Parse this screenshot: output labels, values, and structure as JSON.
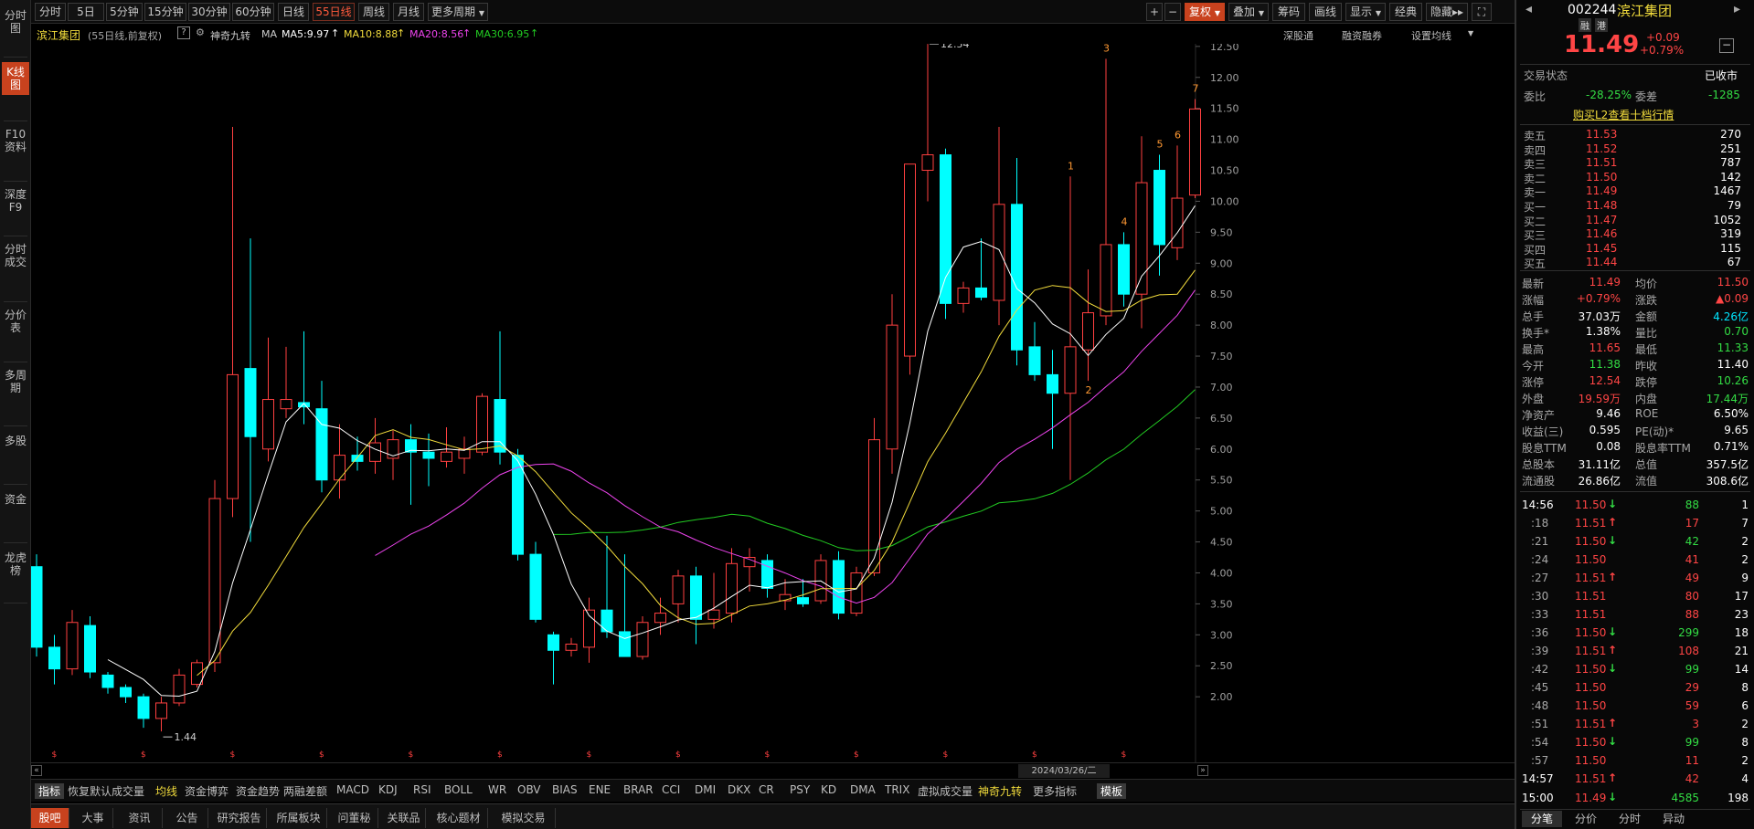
{
  "sidebar": {
    "items": [
      {
        "label": "分时图"
      },
      {
        "label": "K线图"
      },
      {
        "label": "F10资料"
      },
      {
        "label": "深度F9"
      },
      {
        "label": "分时成交"
      },
      {
        "label": "分价表"
      },
      {
        "label": "多周期"
      },
      {
        "label": "多股"
      },
      {
        "label": "资金"
      },
      {
        "label": "龙虎榜"
      }
    ]
  },
  "period_bar": {
    "periods": [
      "分时",
      "5日",
      "5分钟",
      "15分钟",
      "30分钟",
      "60分钟",
      "日线",
      "55日线",
      "周线",
      "月线",
      "更多周期"
    ],
    "right": {
      "plus": "+",
      "minus": "−",
      "fuquan": "复权",
      "overlay": "叠加",
      "chips": "筹码",
      "draw": "画线",
      "display": "显示",
      "classic": "经典",
      "hide": "隐藏",
      "expand": "⛶"
    }
  },
  "info_bar": {
    "name": "滨江集团",
    "period_note": "(55日线,前复权)",
    "help": "?",
    "indicator": "神奇九转",
    "ma_label": "MA",
    "ma5": "MA5:9.97",
    "ma10": "MA10:8.88",
    "ma20": "MA20:8.56",
    "ma30": "MA30:6.95",
    "right_links": [
      "深股通",
      "融资融券",
      "设置均线"
    ]
  },
  "chart_data": {
    "type": "candlestick",
    "ylim": [
      1.5,
      12.8
    ],
    "y_ticks": [
      "12.50",
      "12.00",
      "11.50",
      "11.00",
      "10.50",
      "10.00",
      "9.50",
      "9.00",
      "8.50",
      "8.00",
      "7.50",
      "7.00",
      "6.50",
      "6.00",
      "5.50",
      "5.00",
      "4.50",
      "4.00",
      "3.50",
      "3.00",
      "2.50",
      "2.00"
    ],
    "annotations": {
      "high": "12.54",
      "low": "1.44",
      "date": "2024/03/26/二",
      "ex_marker": "$"
    },
    "nine_turn": [
      "1",
      "2",
      "3",
      "4",
      "5",
      "6",
      "7"
    ],
    "candles": [
      {
        "o": 4.1,
        "h": 4.3,
        "l": 2.65,
        "c": 2.8
      },
      {
        "o": 2.8,
        "h": 3.0,
        "l": 2.2,
        "c": 2.45
      },
      {
        "o": 2.45,
        "h": 3.4,
        "l": 2.35,
        "c": 3.2
      },
      {
        "o": 3.15,
        "h": 3.3,
        "l": 2.3,
        "c": 2.4
      },
      {
        "o": 2.35,
        "h": 2.4,
        "l": 2.05,
        "c": 2.15
      },
      {
        "o": 2.15,
        "h": 2.2,
        "l": 1.9,
        "c": 2.0
      },
      {
        "o": 2.0,
        "h": 2.05,
        "l": 1.5,
        "c": 1.65
      },
      {
        "o": 1.65,
        "h": 2.0,
        "l": 1.44,
        "c": 1.9
      },
      {
        "o": 1.9,
        "h": 2.45,
        "l": 1.85,
        "c": 2.35
      },
      {
        "o": 2.2,
        "h": 2.6,
        "l": 2.15,
        "c": 2.55
      },
      {
        "o": 2.55,
        "h": 5.5,
        "l": 2.4,
        "c": 5.2
      },
      {
        "o": 5.2,
        "h": 11.2,
        "l": 4.9,
        "c": 7.2
      },
      {
        "o": 7.3,
        "h": 9.4,
        "l": 4.5,
        "c": 6.2
      },
      {
        "o": 6.0,
        "h": 7.8,
        "l": 5.8,
        "c": 6.8
      },
      {
        "o": 6.65,
        "h": 7.65,
        "l": 6.5,
        "c": 6.8
      },
      {
        "o": 6.75,
        "h": 7.9,
        "l": 6.4,
        "c": 6.68
      },
      {
        "o": 6.65,
        "h": 7.1,
        "l": 5.3,
        "c": 5.5
      },
      {
        "o": 5.5,
        "h": 6.4,
        "l": 5.2,
        "c": 5.9
      },
      {
        "o": 5.9,
        "h": 6.2,
        "l": 5.65,
        "c": 5.8
      },
      {
        "o": 5.8,
        "h": 6.5,
        "l": 5.6,
        "c": 6.1
      },
      {
        "o": 5.85,
        "h": 6.3,
        "l": 5.5,
        "c": 6.15
      },
      {
        "o": 6.15,
        "h": 6.4,
        "l": 5.1,
        "c": 5.95
      },
      {
        "o": 5.95,
        "h": 6.25,
        "l": 5.4,
        "c": 5.85
      },
      {
        "o": 5.8,
        "h": 6.35,
        "l": 5.7,
        "c": 5.95
      },
      {
        "o": 5.85,
        "h": 6.2,
        "l": 5.6,
        "c": 6.0
      },
      {
        "o": 5.95,
        "h": 6.9,
        "l": 5.9,
        "c": 6.85
      },
      {
        "o": 6.8,
        "h": 7.9,
        "l": 5.75,
        "c": 5.95
      },
      {
        "o": 5.9,
        "h": 6.0,
        "l": 4.2,
        "c": 4.3
      },
      {
        "o": 4.3,
        "h": 4.5,
        "l": 3.2,
        "c": 3.25
      },
      {
        "o": 3.0,
        "h": 3.05,
        "l": 2.2,
        "c": 2.75
      },
      {
        "o": 2.75,
        "h": 2.95,
        "l": 2.65,
        "c": 2.85
      },
      {
        "o": 2.8,
        "h": 3.6,
        "l": 2.55,
        "c": 3.4
      },
      {
        "o": 3.4,
        "h": 4.6,
        "l": 2.95,
        "c": 3.05
      },
      {
        "o": 3.05,
        "h": 4.3,
        "l": 2.65,
        "c": 2.65
      },
      {
        "o": 2.65,
        "h": 3.3,
        "l": 2.6,
        "c": 3.2
      },
      {
        "o": 3.2,
        "h": 3.6,
        "l": 3.0,
        "c": 3.35
      },
      {
        "o": 3.5,
        "h": 4.05,
        "l": 3.2,
        "c": 3.95
      },
      {
        "o": 3.95,
        "h": 4.1,
        "l": 2.85,
        "c": 3.25
      },
      {
        "o": 3.25,
        "h": 4.0,
        "l": 3.1,
        "c": 3.4
      },
      {
        "o": 3.35,
        "h": 4.4,
        "l": 3.2,
        "c": 4.15
      },
      {
        "o": 4.1,
        "h": 4.4,
        "l": 3.7,
        "c": 4.25
      },
      {
        "o": 4.2,
        "h": 4.3,
        "l": 3.6,
        "c": 3.75
      },
      {
        "o": 3.55,
        "h": 3.9,
        "l": 3.4,
        "c": 3.65
      },
      {
        "o": 3.6,
        "h": 3.9,
        "l": 3.45,
        "c": 3.5
      },
      {
        "o": 3.55,
        "h": 4.3,
        "l": 3.5,
        "c": 4.2
      },
      {
        "o": 4.2,
        "h": 4.35,
        "l": 3.25,
        "c": 3.35
      },
      {
        "o": 3.35,
        "h": 4.1,
        "l": 3.3,
        "c": 4.0
      },
      {
        "o": 4.0,
        "h": 6.5,
        "l": 3.95,
        "c": 6.15
      },
      {
        "o": 6.0,
        "h": 8.5,
        "l": 5.6,
        "c": 8.0
      },
      {
        "o": 7.5,
        "h": 10.6,
        "l": 7.2,
        "c": 10.6
      },
      {
        "o": 10.5,
        "h": 12.54,
        "l": 10.0,
        "c": 10.75
      },
      {
        "o": 10.75,
        "h": 10.85,
        "l": 8.1,
        "c": 8.35
      },
      {
        "o": 8.35,
        "h": 8.7,
        "l": 8.2,
        "c": 8.6
      },
      {
        "o": 8.6,
        "h": 9.4,
        "l": 8.4,
        "c": 8.45
      },
      {
        "o": 8.4,
        "h": 11.2,
        "l": 8.0,
        "c": 9.95
      },
      {
        "o": 9.95,
        "h": 10.7,
        "l": 7.35,
        "c": 7.6
      },
      {
        "o": 7.65,
        "h": 8.05,
        "l": 7.1,
        "c": 7.2
      },
      {
        "o": 7.2,
        "h": 7.6,
        "l": 6.0,
        "c": 6.9
      },
      {
        "o": 6.9,
        "h": 10.4,
        "l": 5.5,
        "c": 7.65
      },
      {
        "o": 7.6,
        "h": 8.9,
        "l": 7.1,
        "c": 8.2
      },
      {
        "o": 8.15,
        "h": 12.3,
        "l": 8.0,
        "c": 9.3
      },
      {
        "o": 9.3,
        "h": 9.5,
        "l": 8.3,
        "c": 8.5
      },
      {
        "o": 8.5,
        "h": 11.05,
        "l": 7.95,
        "c": 10.3
      },
      {
        "o": 10.5,
        "h": 10.75,
        "l": 8.8,
        "c": 9.3
      },
      {
        "o": 9.25,
        "h": 10.9,
        "l": 9.05,
        "c": 10.05
      },
      {
        "o": 10.1,
        "h": 11.65,
        "l": 10.05,
        "c": 11.49
      }
    ]
  },
  "indicators": [
    "指标",
    "恢复默认",
    "成交量",
    "均线",
    "资金博弈",
    "资金趋势",
    "两融差额",
    "MACD",
    "KDJ",
    "RSI",
    "BOLL",
    "WR",
    "OBV",
    "BIAS",
    "ENE",
    "BRAR",
    "CCI",
    "DMI",
    "DKX",
    "CR",
    "PSY",
    "KD",
    "DMA",
    "TRIX",
    "虚拟成交量",
    "神奇九转",
    "更多指标",
    "模板"
  ],
  "bottom_tabs": [
    "股吧",
    "大事",
    "资讯",
    "公告",
    "研究报告",
    "所属板块",
    "问董秘",
    "关联品种",
    "核心题材",
    "模拟交易"
  ],
  "quote": {
    "code": "002244",
    "name": "滨江集团",
    "price": "11.49",
    "change": "+0.09",
    "change_pct": "+0.79%",
    "badges": [
      "融",
      "港"
    ],
    "status_label": "交易状态",
    "status_value": "已收市",
    "ratio_label": "委比",
    "ratio_value": "-28.25%",
    "diff_label": "委差",
    "diff_value": "-1285",
    "buy_l2": "购买L2查看十档行情",
    "asks": [
      {
        "label": "卖五",
        "price": "11.53",
        "vol": "270"
      },
      {
        "label": "卖四",
        "price": "11.52",
        "vol": "251"
      },
      {
        "label": "卖三",
        "price": "11.51",
        "vol": "787"
      },
      {
        "label": "卖二",
        "price": "11.50",
        "vol": "142"
      },
      {
        "label": "卖一",
        "price": "11.49",
        "vol": "1467"
      }
    ],
    "bids": [
      {
        "label": "买一",
        "price": "11.48",
        "vol": "79"
      },
      {
        "label": "买二",
        "price": "11.47",
        "vol": "1052"
      },
      {
        "label": "买三",
        "price": "11.46",
        "vol": "319"
      },
      {
        "label": "买四",
        "price": "11.45",
        "vol": "115"
      },
      {
        "label": "买五",
        "price": "11.44",
        "vol": "67"
      }
    ],
    "stats": [
      {
        "l1": "最新",
        "v1": "11.49",
        "c1": "red",
        "l2": "均价",
        "v2": "11.50",
        "c2": "red"
      },
      {
        "l1": "涨幅",
        "v1": "+0.79%",
        "c1": "red",
        "l2": "涨跌",
        "v2": "▲0.09",
        "c2": "red"
      },
      {
        "l1": "总手",
        "v1": "37.03万",
        "c1": "white",
        "l2": "金额",
        "v2": "4.26亿",
        "c2": "cyan"
      },
      {
        "l1": "换手*",
        "v1": "1.38%",
        "c1": "white",
        "l2": "量比",
        "v2": "0.70",
        "c2": "green"
      },
      {
        "l1": "最高",
        "v1": "11.65",
        "c1": "red",
        "l2": "最低",
        "v2": "11.33",
        "c2": "green"
      },
      {
        "l1": "今开",
        "v1": "11.38",
        "c1": "green",
        "l2": "昨收",
        "v2": "11.40",
        "c2": "white"
      },
      {
        "l1": "涨停",
        "v1": "12.54",
        "c1": "red",
        "l2": "跌停",
        "v2": "10.26",
        "c2": "green"
      },
      {
        "l1": "外盘",
        "v1": "19.59万",
        "c1": "red",
        "l2": "内盘",
        "v2": "17.44万",
        "c2": "green"
      },
      {
        "l1": "净资产",
        "v1": "9.46",
        "c1": "white",
        "l2": "ROE",
        "v2": "6.50%",
        "c2": "white"
      },
      {
        "l1": "收益(三)",
        "v1": "0.595",
        "c1": "white",
        "l2": "PE(动)*",
        "v2": "9.65",
        "c2": "white"
      },
      {
        "l1": "股息TTM",
        "v1": "0.08",
        "c1": "white",
        "l2": "股息率TTM",
        "v2": "0.71%",
        "c2": "white"
      },
      {
        "l1": "总股本",
        "v1": "31.11亿",
        "c1": "white",
        "l2": "总值",
        "v2": "357.5亿",
        "c2": "white"
      },
      {
        "l1": "流通股",
        "v1": "26.86亿",
        "c1": "white",
        "l2": "流值",
        "v2": "308.6亿",
        "c2": "white"
      }
    ],
    "ticks": [
      {
        "t": "14:56",
        "p": "11.50",
        "a": "down",
        "v": "88",
        "n": "1"
      },
      {
        "t": ":18",
        "p": "11.51",
        "a": "up",
        "v": "17",
        "n": "7"
      },
      {
        "t": ":21",
        "p": "11.50",
        "a": "down",
        "v": "42",
        "n": "2"
      },
      {
        "t": ":24",
        "p": "11.50",
        "a": "",
        "v": "41",
        "n": "2"
      },
      {
        "t": ":27",
        "p": "11.51",
        "a": "up",
        "v": "49",
        "n": "9"
      },
      {
        "t": ":30",
        "p": "11.51",
        "a": "",
        "v": "80",
        "n": "17"
      },
      {
        "t": ":33",
        "p": "11.51",
        "a": "",
        "v": "88",
        "n": "23"
      },
      {
        "t": ":36",
        "p": "11.50",
        "a": "down",
        "v": "299",
        "n": "18"
      },
      {
        "t": ":39",
        "p": "11.51",
        "a": "up",
        "v": "108",
        "n": "21"
      },
      {
        "t": ":42",
        "p": "11.50",
        "a": "down",
        "v": "99",
        "n": "14"
      },
      {
        "t": ":45",
        "p": "11.50",
        "a": "",
        "v": "29",
        "n": "8"
      },
      {
        "t": ":48",
        "p": "11.50",
        "a": "",
        "v": "59",
        "n": "6"
      },
      {
        "t": ":51",
        "p": "11.51",
        "a": "up",
        "v": "3",
        "n": "2"
      },
      {
        "t": ":54",
        "p": "11.50",
        "a": "down",
        "v": "99",
        "n": "8"
      },
      {
        "t": ":57",
        "p": "11.50",
        "a": "",
        "v": "11",
        "n": "2"
      },
      {
        "t": "14:57",
        "p": "11.51",
        "a": "up",
        "v": "42",
        "n": "4"
      },
      {
        "t": "15:00",
        "p": "11.49",
        "a": "down",
        "v": "4585",
        "n": "198"
      }
    ],
    "tabs": [
      "分笔",
      "分价",
      "分时",
      "异动"
    ]
  }
}
